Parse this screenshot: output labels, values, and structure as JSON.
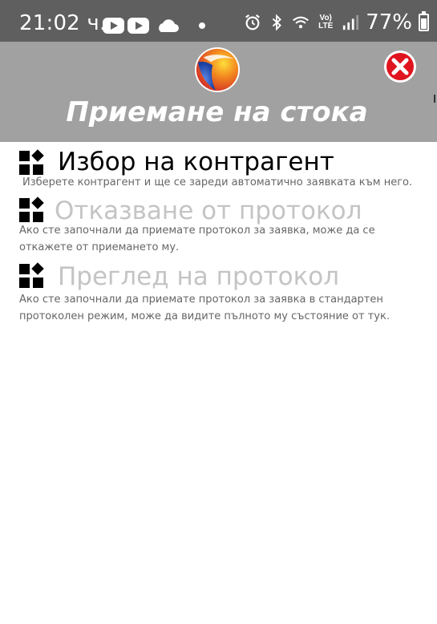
{
  "status_bar": {
    "time": "21:02 ч.",
    "left_icons": [
      "youtube-icon",
      "youtube-icon",
      "cloud-icon",
      "notification-dot-icon"
    ],
    "right_icons": [
      "alarm-icon",
      "bluetooth-icon",
      "wifi-icon",
      "volte-icon",
      "signal-icon",
      "battery-icon"
    ],
    "volte_label_top": "Vo)",
    "volte_label_bottom": "LTE",
    "battery": "77%"
  },
  "header": {
    "title": "Приемане на стока",
    "background": "#a1a1a1",
    "close_icon": "close-icon"
  },
  "menu": {
    "items": [
      {
        "title": "Избор на контрагент",
        "description": "Изберете контрагент и ще се зареди автоматично заявката към него.",
        "state": "active",
        "icon": "widgets-icon"
      },
      {
        "title": "Отказване от протокол",
        "description": "Ако сте започнали да приемате протокол за заявка, може да се откажете от приемането му.",
        "state": "disabled",
        "icon": "widgets-icon"
      },
      {
        "title": "Преглед на протокол",
        "description": "Ако сте започнали да приемате протокол за заявка в стандартен протоколен режим, може да видите пълното му състояние от тук.",
        "state": "disabled",
        "icon": "widgets-icon"
      }
    ]
  },
  "colors": {
    "status_bar": "#5f5f5f",
    "header": "#a1a1a1",
    "title_text": "#ffffff",
    "active_item": "#000000",
    "disabled_item": "#c4c4c4",
    "description": "#666666",
    "close_red": "#e0141e"
  }
}
